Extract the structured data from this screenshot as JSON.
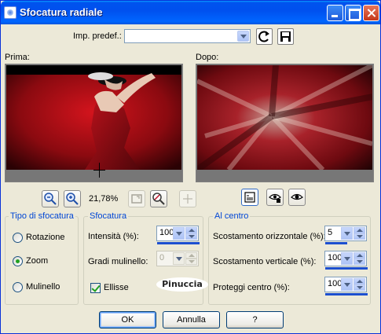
{
  "window": {
    "title": "Sfocatura radiale"
  },
  "preset": {
    "label": "Imp. predef.:",
    "value": ""
  },
  "preview": {
    "before_label": "Prima:",
    "after_label": "Dopo:",
    "zoom": "21,78%"
  },
  "tipo": {
    "legend": "Tipo di sfocatura",
    "options": [
      {
        "label": "Rotazione",
        "checked": false
      },
      {
        "label": "Zoom",
        "checked": true
      },
      {
        "label": "Mulinello",
        "checked": false
      }
    ]
  },
  "sfocatura": {
    "legend": "Sfocatura",
    "intensity_label": "Intensità (%):",
    "intensity_value": "100",
    "twist_label": "Gradi mulinello:",
    "twist_value": "0",
    "ellipse_label": "Ellisse",
    "ellipse_checked": true
  },
  "watermark": "Pinuccia",
  "centro": {
    "legend": "Al centro",
    "h_offset_label": "Scostamento orizzontale (%):",
    "h_offset_value": "5",
    "v_offset_label": "Scostamento verticale (%):",
    "v_offset_value": "100",
    "protect_label": "Proteggi centro (%):",
    "protect_value": "100"
  },
  "buttons": {
    "ok": "OK",
    "cancel": "Annulla",
    "help": "?"
  },
  "colors": {
    "title_blue": "#0054e3",
    "legend_blue": "#0046d5",
    "preview_red": "#a0141c"
  }
}
